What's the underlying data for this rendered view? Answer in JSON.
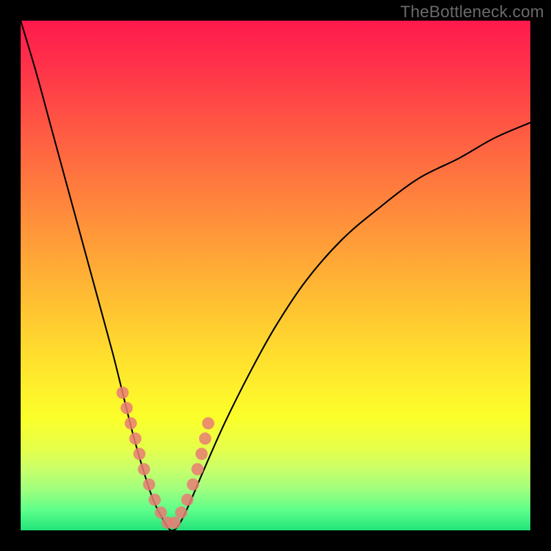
{
  "watermark": "TheBottleneck.com",
  "colors": {
    "background": "#000000",
    "curve": "#000000",
    "marker": "#e97c74",
    "gradient_top": "#ff1a4d",
    "gradient_bottom": "#22e37a"
  },
  "chart_data": {
    "type": "line",
    "title": "",
    "xlabel": "",
    "ylabel": "",
    "xlim": [
      0,
      100
    ],
    "ylim": [
      0,
      100
    ],
    "series": [
      {
        "name": "bottleneck-curve",
        "x": [
          0,
          3,
          6,
          9,
          12,
          15,
          18,
          20,
          22,
          24,
          26,
          28,
          29.5,
          31,
          33,
          36,
          40,
          45,
          50,
          56,
          63,
          70,
          78,
          86,
          93,
          100
        ],
        "y": [
          100,
          90,
          79,
          68,
          57,
          46,
          35,
          27,
          19,
          12,
          6,
          2,
          0,
          1,
          5,
          12,
          21,
          31,
          40,
          49,
          57,
          63,
          69,
          73,
          77,
          80
        ]
      }
    ],
    "markers": {
      "name": "highlighted-points",
      "x": [
        20.0,
        20.8,
        21.6,
        22.5,
        23.3,
        24.2,
        25.2,
        26.3,
        27.5,
        28.8,
        30.2,
        31.5,
        32.7,
        33.8,
        34.7,
        35.5,
        36.2,
        36.8
      ],
      "y": [
        27.0,
        24.0,
        21.0,
        18.0,
        15.0,
        12.0,
        9.0,
        6.0,
        3.5,
        1.5,
        1.5,
        3.5,
        6.0,
        9.0,
        12.0,
        15.0,
        18.0,
        21.0
      ],
      "radius_domain_units": 1.2
    }
  }
}
